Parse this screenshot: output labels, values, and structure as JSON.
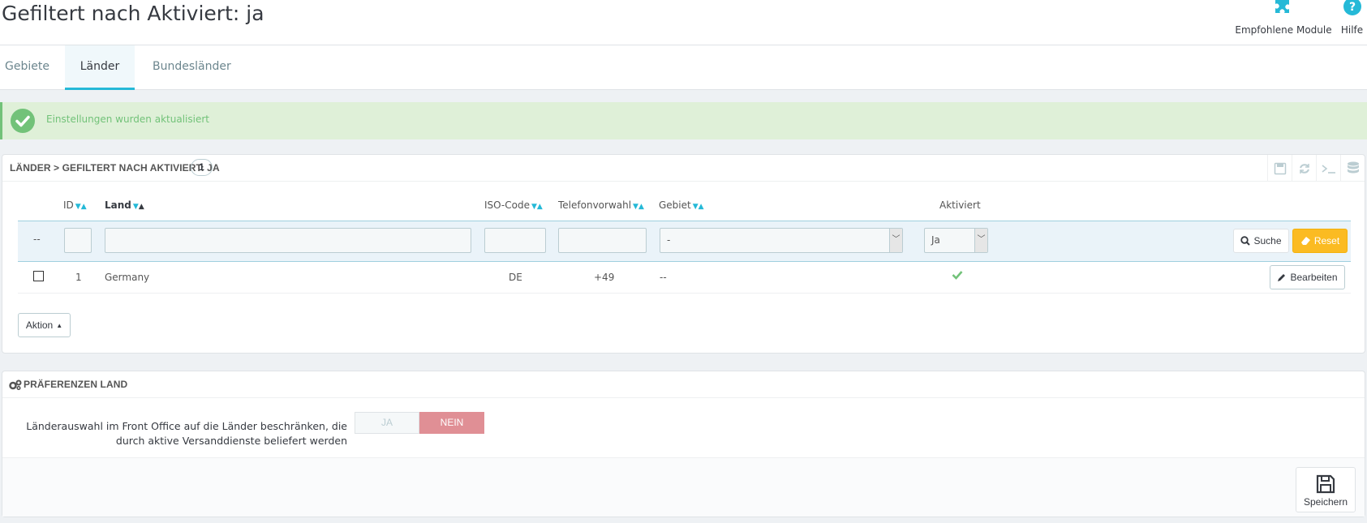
{
  "header": {
    "title": "Gefiltert nach Aktiviert: ja",
    "toolbar": {
      "modules_label": "Empfohlene Module",
      "help_label": "Hilfe"
    }
  },
  "tabs": [
    {
      "label": "Gebiete",
      "active": false
    },
    {
      "label": "Länder",
      "active": true
    },
    {
      "label": "Bundesländer",
      "active": false
    }
  ],
  "alert": {
    "text": "Einstellungen wurden aktualisiert"
  },
  "countries_panel": {
    "title": "Länder > Gefiltert nach Aktiviert: ja",
    "count": "1",
    "columns": {
      "id": "ID",
      "land": "Land",
      "iso": "ISO-Code",
      "phone": "Telefonvorwahl",
      "zone": "Gebiet",
      "active": "Aktiviert"
    },
    "filters": {
      "bulk": "--",
      "zone_selected": "-",
      "active_selected": "Ja",
      "search_label": "Suche",
      "reset_label": "Reset"
    },
    "rows": [
      {
        "id": "1",
        "land": "Germany",
        "iso": "DE",
        "phone": "+49",
        "zone": "--",
        "active": true,
        "edit_label": "Bearbeiten"
      }
    ],
    "action_label": "Aktion"
  },
  "prefs_panel": {
    "title": "Präferenzen Land",
    "restrict_label": "Länderauswahl im Front Office auf die Länder beschränken, die durch aktive Versanddienste beliefert werden",
    "switch_yes": "JA",
    "switch_no": "NEIN",
    "switch_value": "NEIN",
    "save_label": "Speichern"
  },
  "colors": {
    "accent": "#25b9d7",
    "success": "#72c279",
    "warning": "#fbbb22",
    "danger_soft": "#e08f95"
  }
}
